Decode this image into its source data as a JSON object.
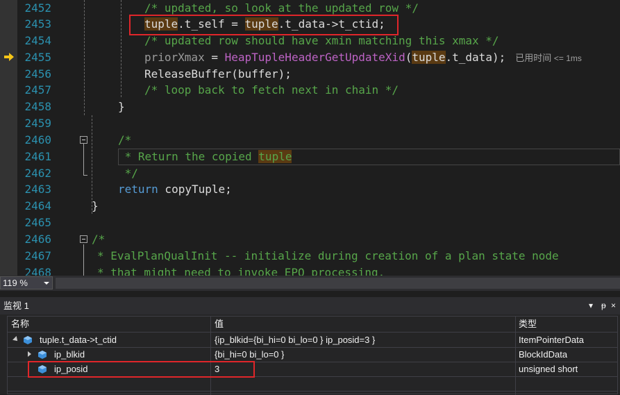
{
  "editor": {
    "lines": [
      {
        "num": "2452"
      },
      {
        "num": "2453"
      },
      {
        "num": "2454"
      },
      {
        "num": "2455"
      },
      {
        "num": "2456"
      },
      {
        "num": "2457"
      },
      {
        "num": "2458"
      },
      {
        "num": "2459"
      },
      {
        "num": "2460"
      },
      {
        "num": "2461"
      },
      {
        "num": "2462"
      },
      {
        "num": "2463"
      },
      {
        "num": "2464"
      },
      {
        "num": "2465"
      },
      {
        "num": "2466"
      },
      {
        "num": "2467"
      },
      {
        "num": "2468"
      }
    ],
    "code": {
      "l2452": "/* updated, so look at the updated row */",
      "l2453_a": "tuple",
      "l2453_b": ".t_self = ",
      "l2453_c": "tuple",
      "l2453_d": ".t_data->t_ctid;",
      "l2454": "/* updated row should have xmin matching this xmax */",
      "l2455_a": "priorXmax",
      "l2455_b": " = ",
      "l2455_c": "HeapTupleHeaderGetUpdateXid",
      "l2455_d": "(",
      "l2455_e": "tuple",
      "l2455_f": ".t_data);",
      "l2455_hint": "已用时间",
      "l2455_hint2": "<= 1ms",
      "l2456": "ReleaseBuffer(buffer);",
      "l2457": "/* loop back to fetch next in chain */",
      "l2458": "}",
      "l2460": "/*",
      "l2461_a": " * Return the copied ",
      "l2461_b": "tuple",
      "l2462": " */",
      "l2463_a": "return",
      "l2463_b": " copyTuple;",
      "l2464": "}",
      "l2466": "/*",
      "l2467": "* EvalPlanQualInit -- initialize during creation of a plan state node",
      "l2468": "* that might need to invoke EPQ processing."
    }
  },
  "zoom": {
    "value": "119 %"
  },
  "watch": {
    "title": "监视 1",
    "pin_glyph": "▾",
    "pin2_glyph": "ᵽ",
    "close_glyph": "×",
    "columns": {
      "name": "名称",
      "value": "值",
      "type": "类型"
    },
    "rows": [
      {
        "name": "tuple.t_data->t_ctid",
        "value": "{ip_blkid={bi_hi=0 bi_lo=0 } ip_posid=3 }",
        "type": "ItemPointerData"
      },
      {
        "name": "ip_blkid",
        "value": "{bi_hi=0 bi_lo=0 }",
        "type": "BlockIdData"
      },
      {
        "name": "ip_posid",
        "value": "3",
        "type": "unsigned short"
      }
    ]
  },
  "colors": {
    "background": "#1e1e1e",
    "comment": "#57a64a",
    "keyword": "#569cd6",
    "macro": "#bd63c5",
    "line_number": "#2b91af",
    "highlight": "#5a3a12",
    "annotation_red": "#e0262a"
  },
  "icons": {
    "instruction_pointer": "arrow-right-yellow",
    "watch_item": "blue-cube"
  }
}
